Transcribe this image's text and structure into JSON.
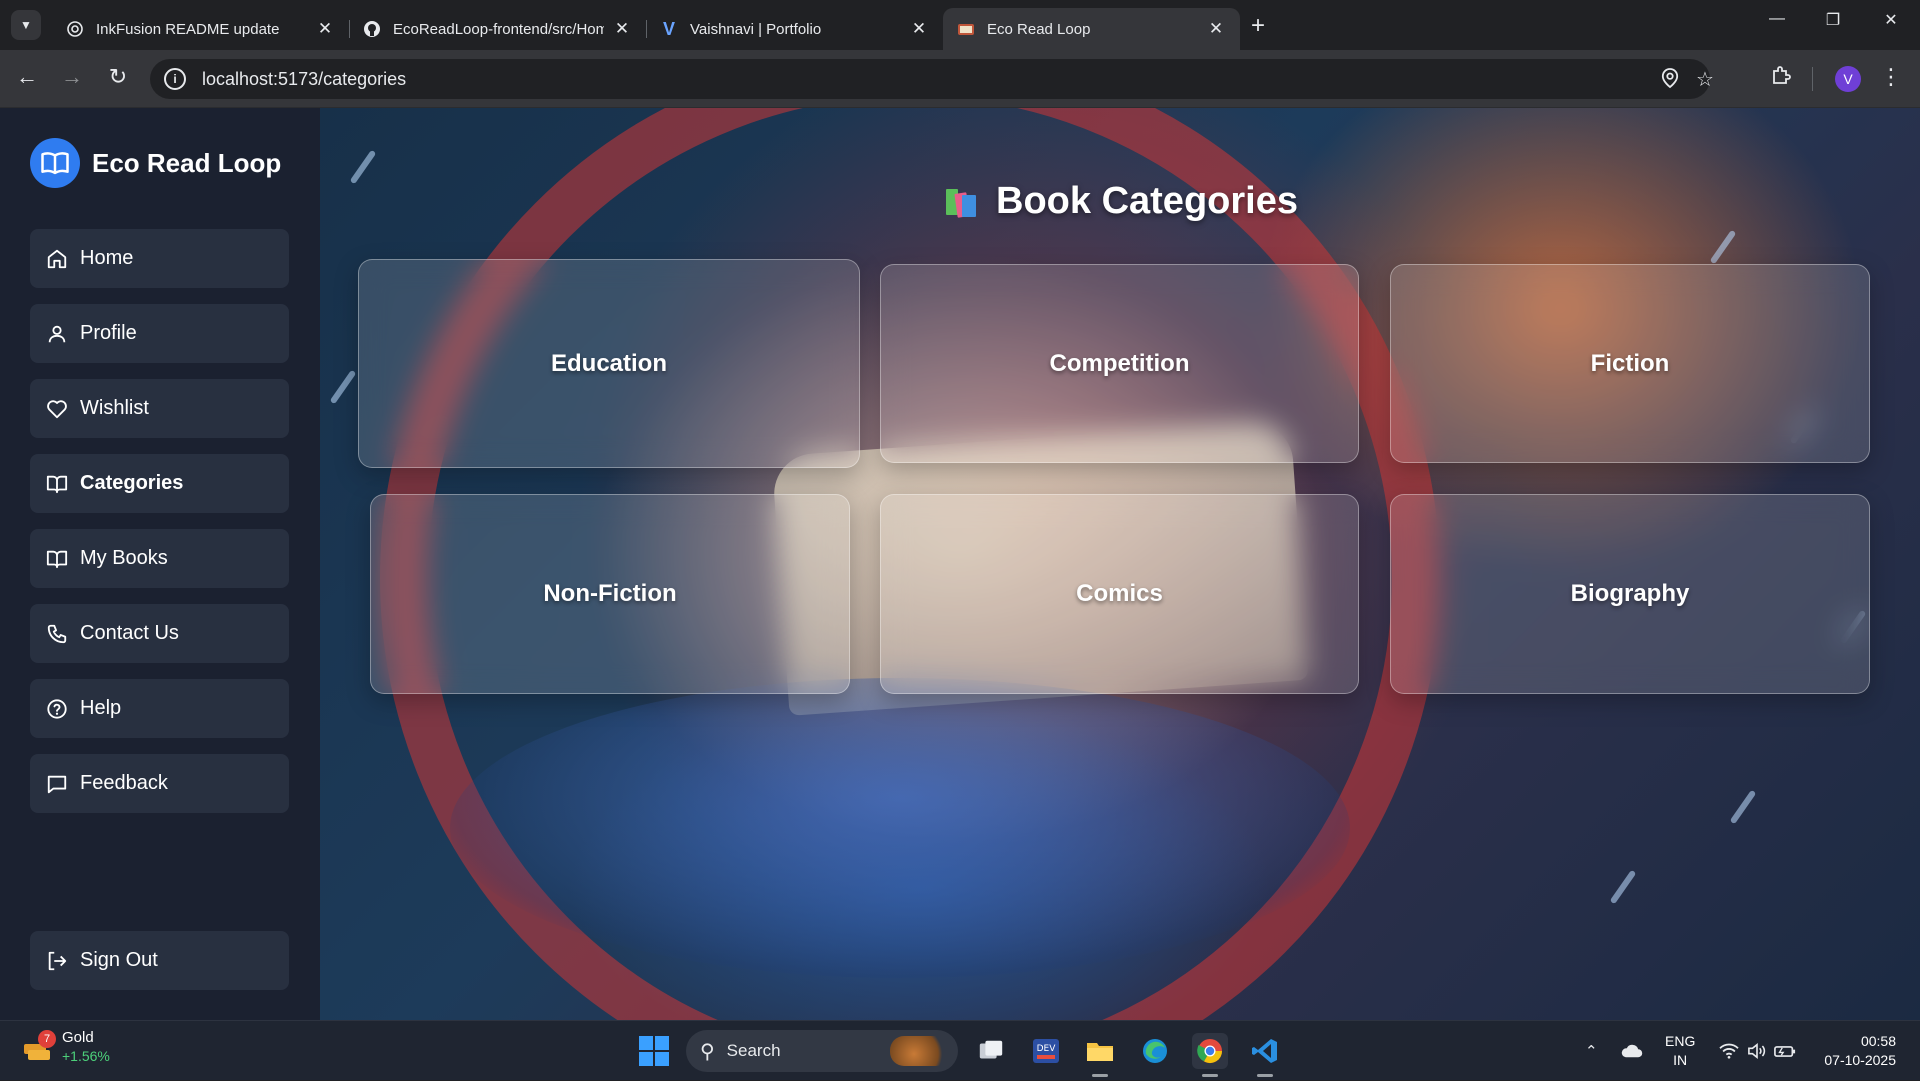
{
  "browser": {
    "tabs": [
      {
        "title": "InkFusion README update",
        "favicon": "openai-icon",
        "active": false
      },
      {
        "title": "EcoReadLoop-frontend/src/Hom",
        "favicon": "github-icon",
        "active": false
      },
      {
        "title": "Vaishnavi | Portfolio",
        "favicon": "portfolio-v-icon",
        "active": false
      },
      {
        "title": "Eco Read Loop",
        "favicon": "eco-read-loop-icon",
        "active": true
      }
    ],
    "url": "localhost:5173/categories",
    "profile_initial": "V"
  },
  "sidebar": {
    "brand": "Eco Read Loop",
    "items": [
      {
        "label": "Home",
        "icon": "home-icon"
      },
      {
        "label": "Profile",
        "icon": "user-icon"
      },
      {
        "label": "Wishlist",
        "icon": "heart-icon"
      },
      {
        "label": "Categories",
        "icon": "book-open-icon",
        "active": true
      },
      {
        "label": "My Books",
        "icon": "book-open-icon"
      },
      {
        "label": "Contact Us",
        "icon": "phone-icon"
      },
      {
        "label": "Help",
        "icon": "help-circle-icon"
      },
      {
        "label": "Feedback",
        "icon": "message-square-icon"
      }
    ],
    "sign_out": "Sign Out"
  },
  "main": {
    "title": "Book Categories",
    "categories": [
      {
        "label": "Education"
      },
      {
        "label": "Competition"
      },
      {
        "label": "Fiction"
      },
      {
        "label": "Non-Fiction"
      },
      {
        "label": "Comics"
      },
      {
        "label": "Biography"
      }
    ]
  },
  "taskbar": {
    "widget": {
      "badge": "7",
      "title": "Gold",
      "change": "+1.56%"
    },
    "search_label": "Search",
    "language": {
      "line1": "ENG",
      "line2": "IN"
    },
    "time": "00:58",
    "date": "07-10-2025"
  },
  "colors": {
    "sidebar_bg": "#1b2130",
    "nav_item_bg": "#283040",
    "brand_blue": "#2f7cf0",
    "browser_bg": "#202124"
  }
}
